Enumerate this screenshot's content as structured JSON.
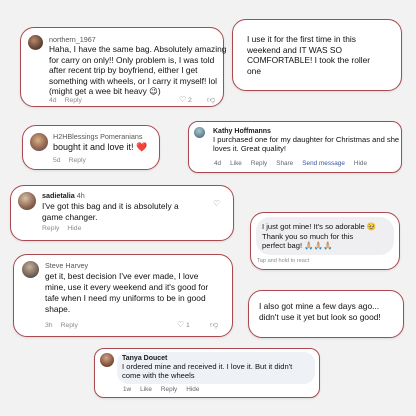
{
  "comments": [
    {
      "username": "northern_1967",
      "lines": [
        "Haha, I have the same bag. Absolutely amazing",
        "for carry on only!! Only problem is, I was told",
        "after recent trip by boyfriend, either I get",
        "something with wheels, or I carry it myself! lol",
        "(might get a wee bit heavy 😉)"
      ],
      "time": "4d",
      "reply": "Reply",
      "like_count": "2"
    },
    {
      "lines": [
        "I use it for the first time in this",
        "weekend and IT WAS SO",
        "COMFORTABLE! I took the roller",
        "one"
      ]
    },
    {
      "username": "H2HBlessings Pomeranians",
      "text": "bought it and love it! ❤️",
      "time": "5d",
      "reply": "Reply"
    },
    {
      "name": "Kathy Hoffmanns",
      "lines": [
        "I purchased one for my daughter for Christmas and she",
        "loves it. Great quality!"
      ],
      "time": "4d",
      "actions": [
        "Like",
        "Reply",
        "Share",
        "Send message",
        "Hide"
      ]
    },
    {
      "username": "sadietalia",
      "time_inline": "4h",
      "lines": [
        "I've got this bag and it is absolutely a",
        "game changer."
      ],
      "reply": "Reply",
      "hide": "Hide"
    },
    {
      "lines": [
        "I just got mine! It's so adorable 🥹",
        "Thank you so much for this",
        "perfect bag! 🙏🏼🙏🏼🙏🏼"
      ],
      "hint": "Tap and hold to react"
    },
    {
      "username": "Steve Harvey",
      "lines": [
        "get it, best decision I've ever made, I love",
        "mine, use it every weekend and it's good for",
        "tafe when I need my uniforms to be in good",
        "shape."
      ],
      "time": "3h",
      "reply": "Reply",
      "like_count": "1"
    },
    {
      "lines": [
        "I also got mine a few days ago...",
        "didn't use it yet but look so good!"
      ]
    },
    {
      "name": "Tanya Doucet",
      "lines": [
        "I ordered mine and received it. I love it. But it didn't",
        "come with the wheels"
      ],
      "time": "1w",
      "actions": [
        "Like",
        "Reply",
        "Hide"
      ]
    }
  ]
}
